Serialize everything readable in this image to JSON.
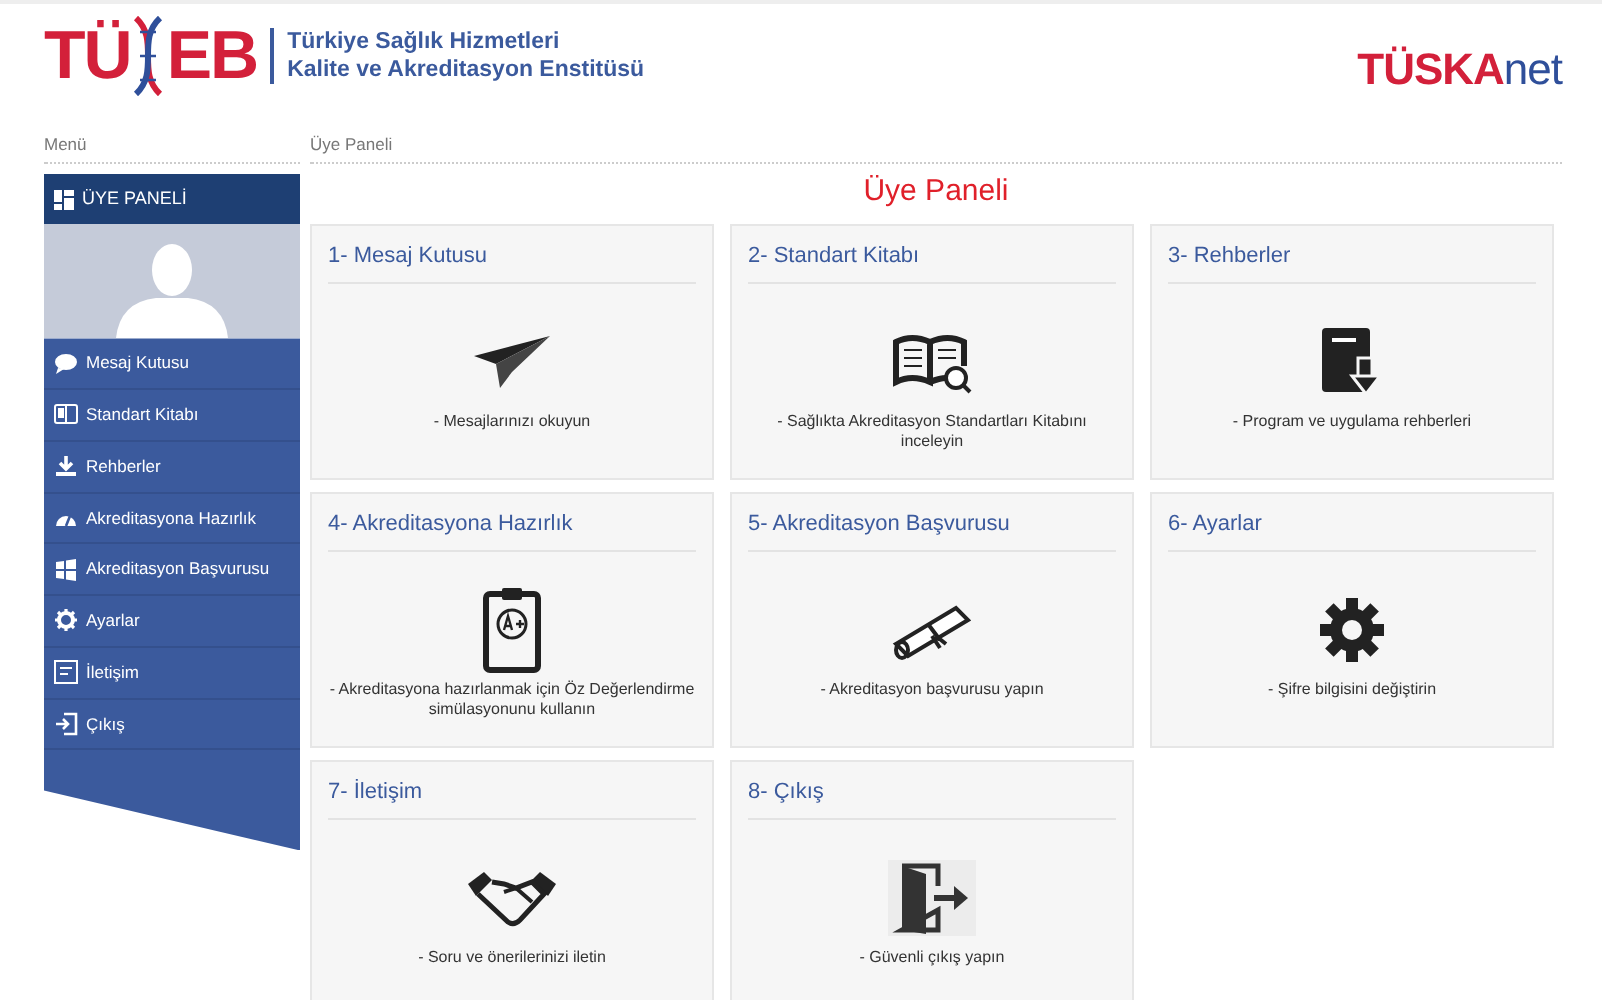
{
  "header": {
    "logo": {
      "left": "TÜ",
      "right": "EB"
    },
    "institute": [
      "Türkiye Sağlık Hizmetleri",
      "Kalite ve Akreditasyon Enstitüsü"
    ],
    "brand": {
      "red": "TÜSKA",
      "blue": "net"
    }
  },
  "sidebar": {
    "label": "Menü",
    "title": "ÜYE PANELİ",
    "items": [
      {
        "kind": "chat",
        "label": "Mesaj Kutusu"
      },
      {
        "kind": "book",
        "label": "Standart Kitabı"
      },
      {
        "kind": "download",
        "label": "Rehberler"
      },
      {
        "kind": "gauge",
        "label": "Akreditasyona Hazırlık"
      },
      {
        "kind": "windows",
        "label": "Akreditasyon Başvurusu"
      },
      {
        "kind": "gear",
        "label": "Ayarlar"
      },
      {
        "kind": "contact",
        "label": "İletişim"
      },
      {
        "kind": "exit",
        "label": "Çıkış"
      }
    ]
  },
  "main": {
    "breadcrumb": "Üye Paneli",
    "title": "Üye Paneli",
    "cards": [
      {
        "kind": "plane",
        "title": "1- Mesaj Kutusu",
        "text": "- Mesajlarınızı okuyun"
      },
      {
        "kind": "book",
        "title": "2- Standart Kitabı",
        "text": "- Sağlıkta Akreditasyon Standartları Kitabını inceleyin"
      },
      {
        "kind": "download",
        "title": "3- Rehberler",
        "text": "- Program ve uygulama rehberleri"
      },
      {
        "kind": "clipboard",
        "title": "4- Akreditasyona Hazırlık",
        "text": "- Akreditasyona hazırlanmak için Öz Değerlendirme simülasyonunu kullanın"
      },
      {
        "kind": "diploma",
        "title": "5- Akreditasyon Başvurusu",
        "text": "- Akreditasyon başvurusu yapın"
      },
      {
        "kind": "gear",
        "title": "6- Ayarlar",
        "text": "- Şifre bilgisini değiştirin"
      },
      {
        "kind": "handshake",
        "title": "7- İletişim",
        "text": "- Soru ve önerilerinizi iletin"
      },
      {
        "kind": "exit",
        "title": "8- Çıkış",
        "text": "- Güvenli çıkış yapın"
      }
    ]
  }
}
